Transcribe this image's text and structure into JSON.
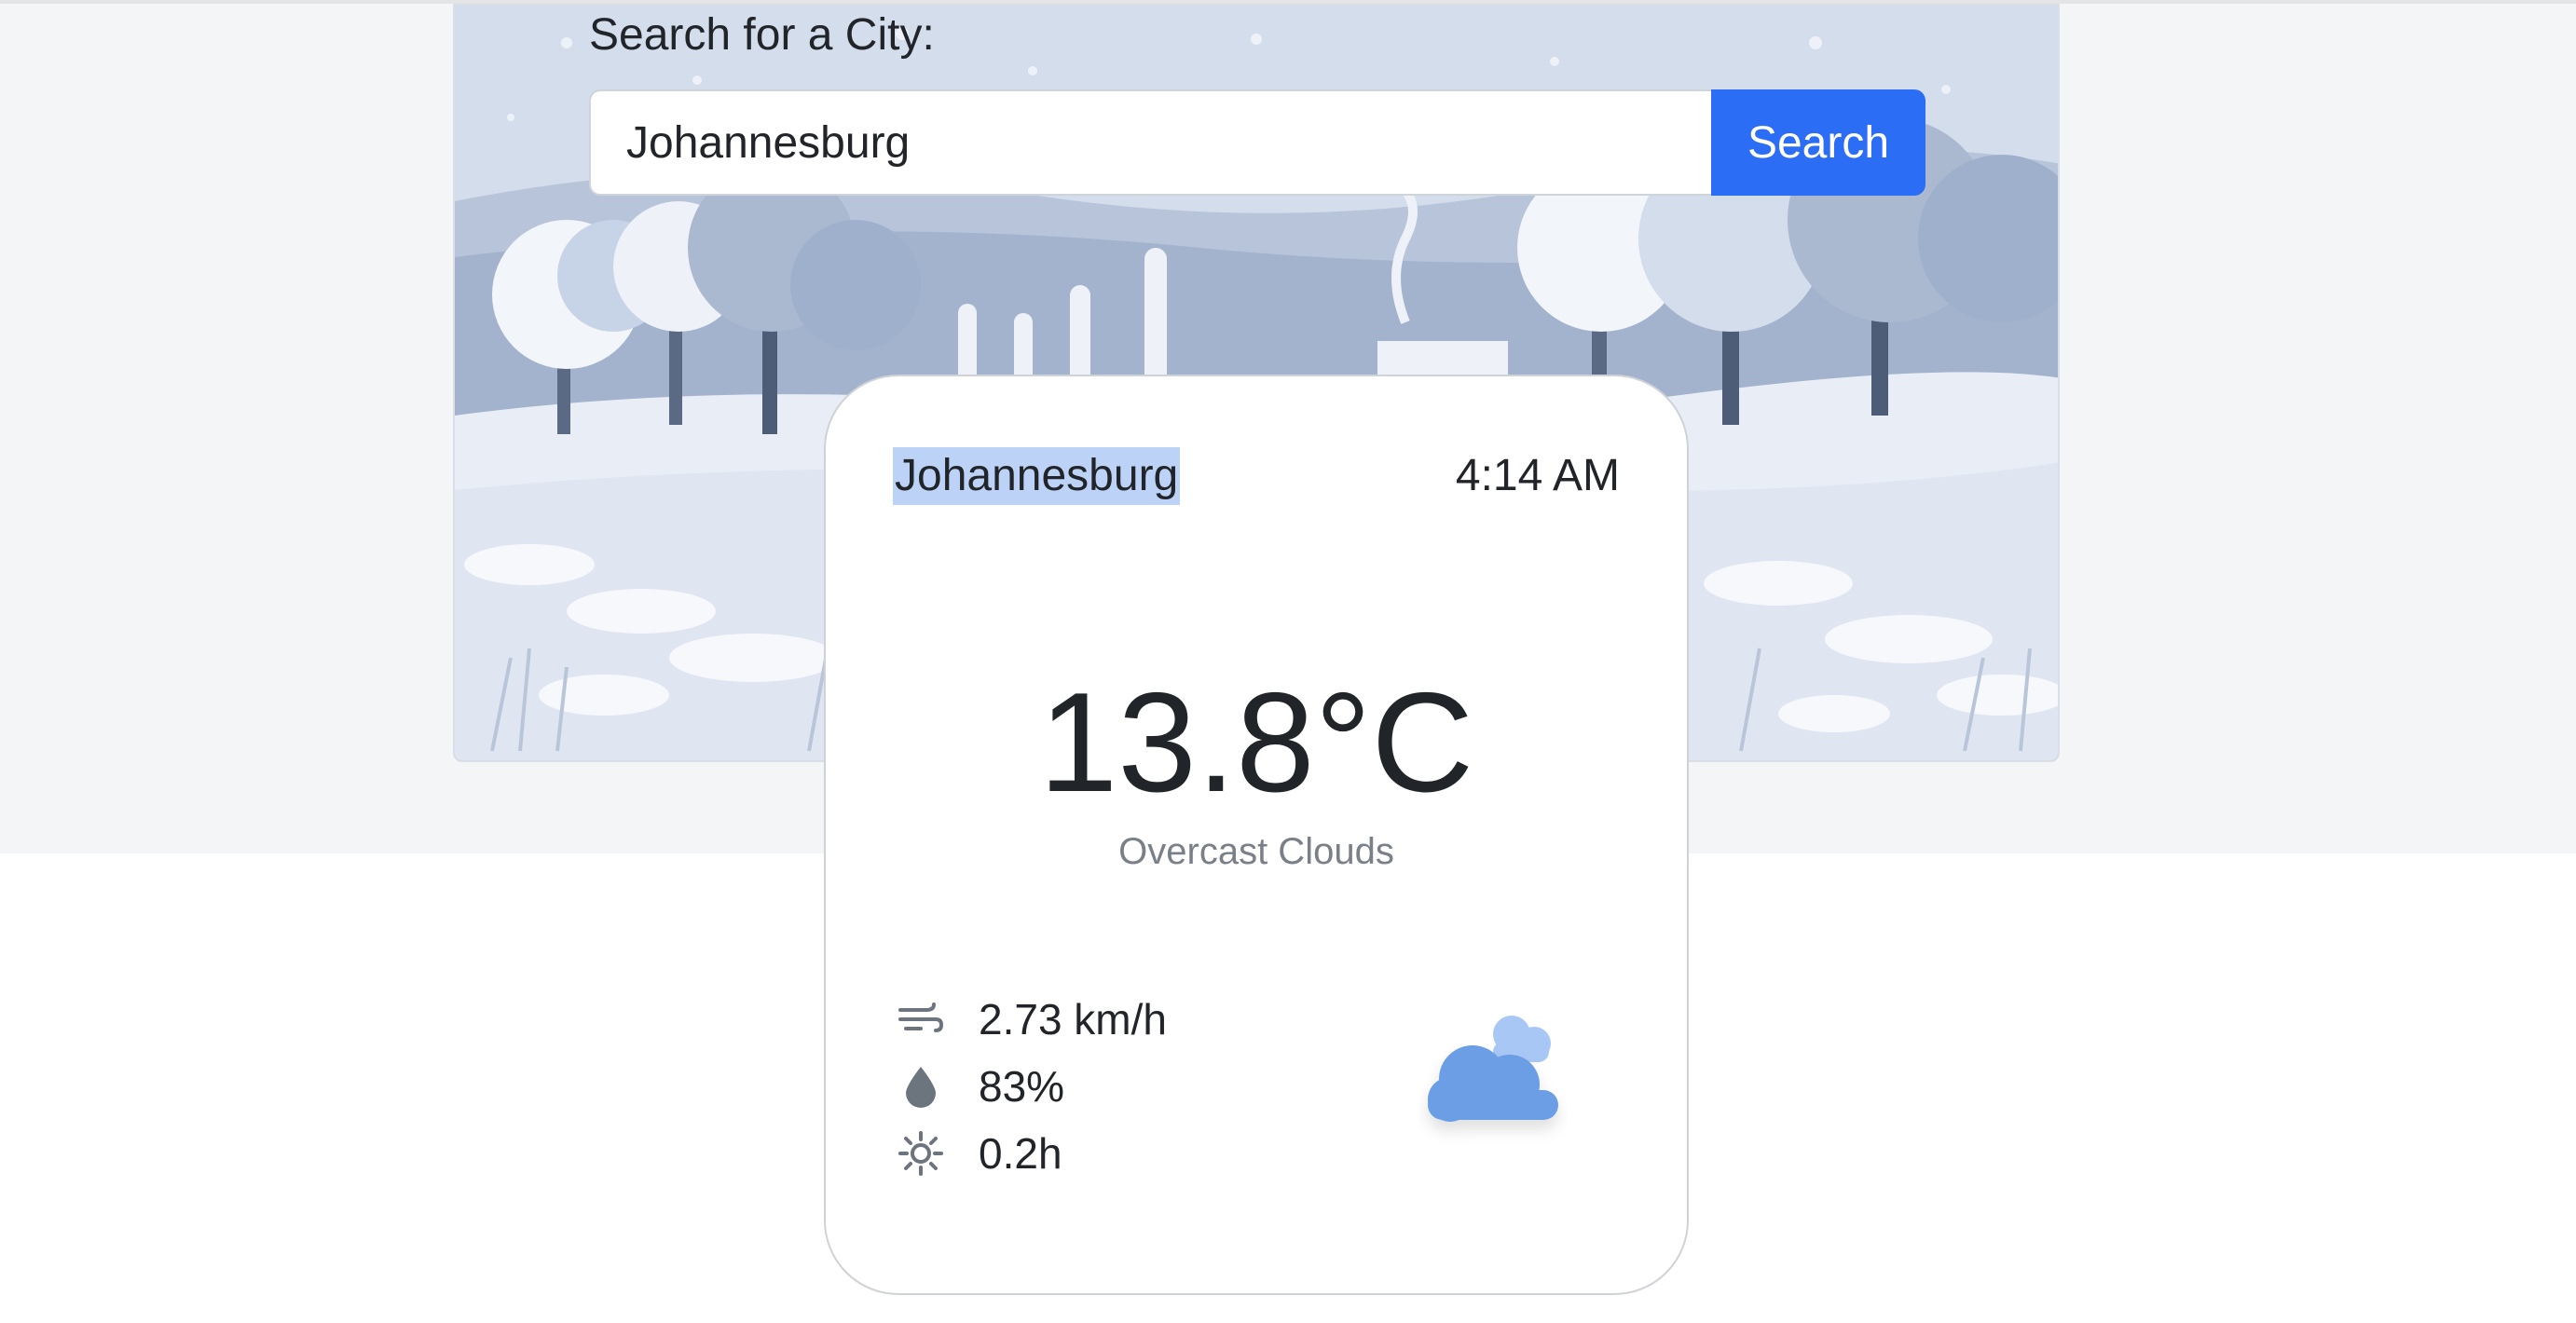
{
  "search": {
    "label": "Search for a City:",
    "value": "Johannesburg",
    "placeholder": "",
    "button_label": "Search"
  },
  "card": {
    "city": "Johannesburg",
    "time": "4:14 AM",
    "temperature": "13.8°C",
    "description": "Overcast Clouds",
    "stats": {
      "wind": "2.73 km/h",
      "humidity": "83%",
      "sunshine": "0.2h"
    },
    "icons": {
      "wind": "wind-icon",
      "humidity": "droplet-icon",
      "sunshine": "sun-icon",
      "condition": "overcast-clouds-icon"
    }
  },
  "colors": {
    "accent": "#2c6df5",
    "page_background": "#f4f5f7",
    "highlight": "#bcd3f7",
    "cloud": "#6c9ee6"
  },
  "hero": {
    "illustration": "winter-landscape-illustration"
  }
}
